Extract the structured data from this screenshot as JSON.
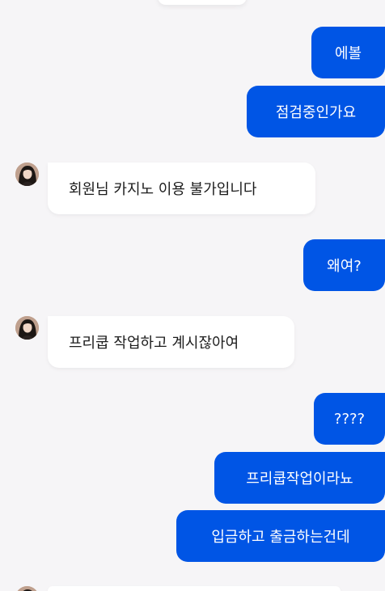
{
  "messages": [
    {
      "from": "me",
      "text": "에볼"
    },
    {
      "from": "me",
      "text": "점검중인가요"
    },
    {
      "from": "agent",
      "text": "회원님 카지노 이용 불가입니다"
    },
    {
      "from": "me",
      "text": "왜여?"
    },
    {
      "from": "agent",
      "text": "프리쿱 작업하고 계시잖아여"
    },
    {
      "from": "me",
      "text": "????"
    },
    {
      "from": "me",
      "text": "프리쿱작업이라뇨"
    },
    {
      "from": "me",
      "text": "입금하고 출금하는건데"
    }
  ],
  "colors": {
    "background": "#f6f5f7",
    "outgoing_bubble": "#0055e5",
    "outgoing_text": "#ffffff",
    "incoming_bubble": "#ffffff",
    "incoming_text": "#1c1c1c"
  }
}
